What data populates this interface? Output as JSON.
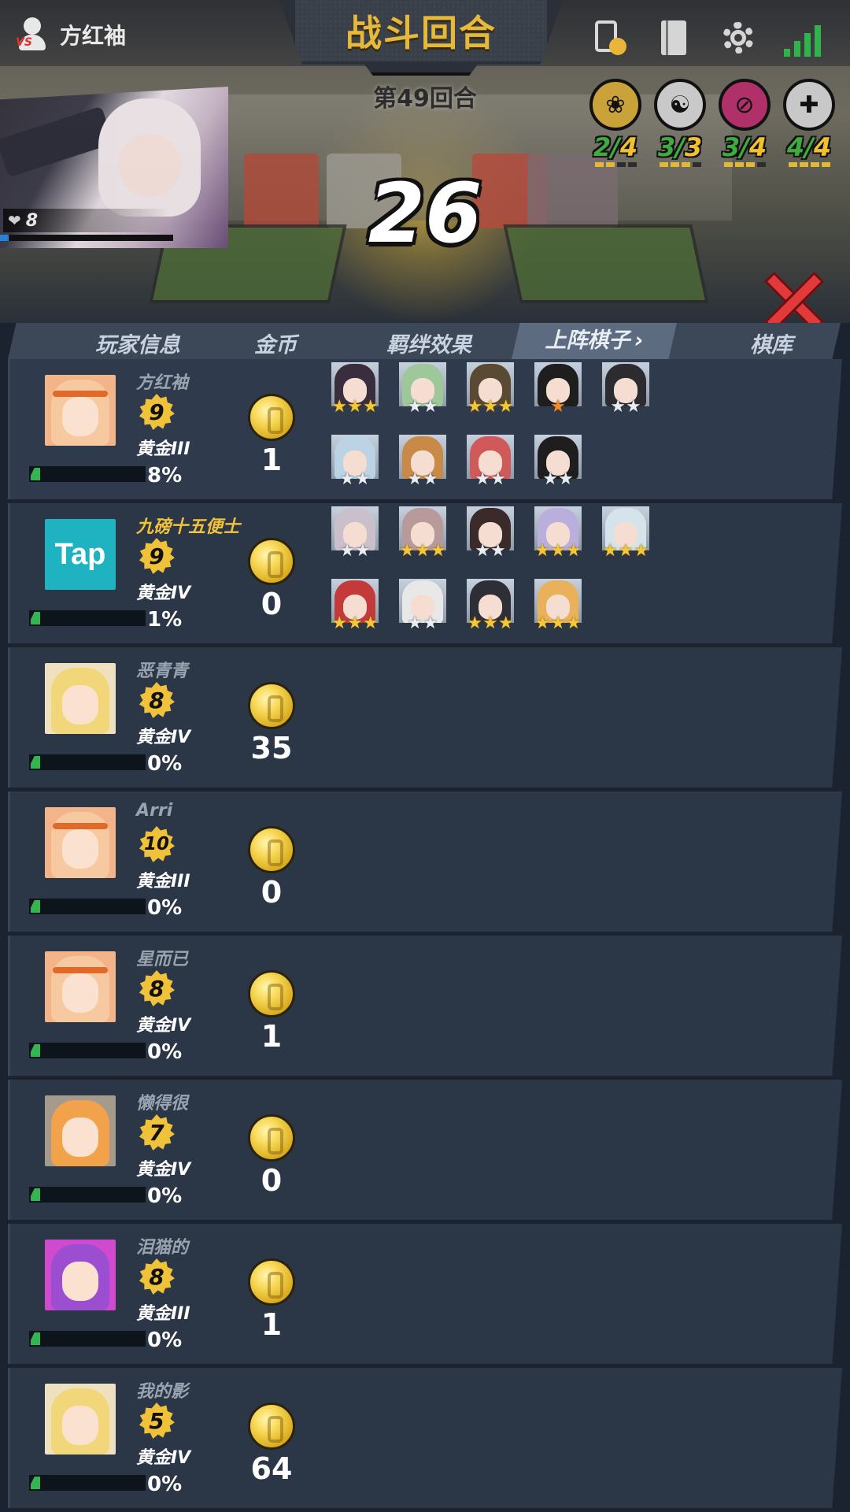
{
  "header": {
    "player_name": "方红袖",
    "title": "战斗回合",
    "round_label": "第49回合",
    "timer": "26",
    "life": "8",
    "life_fraction": 0.05
  },
  "colors": {
    "gold_accent": "#e6b93a",
    "panel": "#2b3646",
    "tab_bar": "#3c4757",
    "xp_fill": "#34b552",
    "close": "#e23a3a"
  },
  "top_icons": [
    "phone-sync-icon",
    "book-icon",
    "gear-icon",
    "signal-icon"
  ],
  "synergies": [
    {
      "icon": "lotus-icon",
      "current": "2",
      "total": "4",
      "disc_color": "#c9a23a",
      "bars": 2
    },
    {
      "icon": "yinyang-icon",
      "current": "3",
      "total": "3",
      "disc_color": "#c9c9c9",
      "bars": 3
    },
    {
      "icon": "sword-circle-icon",
      "current": "3",
      "total": "4",
      "disc_color": "#b0306a",
      "bars": 3
    },
    {
      "icon": "cross-icon",
      "current": "4",
      "total": "4",
      "disc_color": "#c8c8c8",
      "bars": 4
    }
  ],
  "tabs": {
    "player_info": "玩家信息",
    "gold": "金币",
    "synergy": "羁绊效果",
    "deployed": "上阵棋子",
    "bench": "棋库"
  },
  "players": [
    {
      "name": "方红袖",
      "level": "9",
      "rank": "黄金III",
      "pct": "8%",
      "gold": "1",
      "avatar": "orange-hair-girl",
      "name_color": "gray",
      "pieces": [
        {
          "stars": 3,
          "star_type": "gold",
          "hair": "#3a2e3e"
        },
        {
          "stars": 2,
          "star_type": "white",
          "hair": "#9ec79a"
        },
        {
          "stars": 3,
          "star_type": "gold",
          "hair": "#5a4a34"
        },
        {
          "stars": 1,
          "star_type": "orange",
          "hair": "#1e1e1e"
        },
        {
          "stars": 2,
          "star_type": "white",
          "hair": "#2b2b30"
        },
        {
          "stars": 2,
          "star_type": "white",
          "hair": "#bcd3e6"
        },
        {
          "stars": 2,
          "star_type": "white",
          "hair": "#c88a46"
        },
        {
          "stars": 2,
          "star_type": "white",
          "hair": "#d05a5a"
        },
        {
          "stars": 2,
          "star_type": "white",
          "hair": "#1e1e1e"
        }
      ]
    },
    {
      "name": "九磅十五便士",
      "level": "9",
      "rank": "黄金IV",
      "pct": "1%",
      "gold": "0",
      "avatar": "tap",
      "avatar_text": "Tap",
      "name_color": "gold",
      "pieces": [
        {
          "stars": 2,
          "star_type": "white",
          "hair": "#c9c0cc"
        },
        {
          "stars": 3,
          "star_type": "gold",
          "hair": "#b89a9a"
        },
        {
          "stars": 2,
          "star_type": "white",
          "hair": "#3a2a2a"
        },
        {
          "stars": 3,
          "star_type": "gold",
          "hair": "#b9aedc"
        },
        {
          "stars": 3,
          "star_type": "gold",
          "hair": "#d4e4ea"
        },
        {
          "stars": 3,
          "star_type": "gold",
          "hair": "#c23a3a"
        },
        {
          "stars": 2,
          "star_type": "white",
          "hair": "#e8e8e8"
        },
        {
          "stars": 3,
          "star_type": "gold",
          "hair": "#2e2e36"
        },
        {
          "stars": 3,
          "star_type": "gold",
          "hair": "#e9b25a"
        }
      ]
    },
    {
      "name": "恶青青",
      "level": "8",
      "rank": "黄金IV",
      "pct": "0%",
      "gold": "35",
      "avatar": "blonde-cat-girl",
      "name_color": "gray",
      "pieces": []
    },
    {
      "name": "Arri",
      "level": "10",
      "rank": "黄金III",
      "pct": "0%",
      "gold": "0",
      "avatar": "orange-hair-girl",
      "name_color": "gray",
      "pieces": []
    },
    {
      "name": "星而已",
      "level": "8",
      "rank": "黄金IV",
      "pct": "0%",
      "gold": "1",
      "avatar": "orange-hair-girl",
      "name_color": "gray",
      "pieces": []
    },
    {
      "name": "懒得很",
      "level": "7",
      "rank": "黄金IV",
      "pct": "0%",
      "gold": "0",
      "avatar": "spiky-hair-boy",
      "name_color": "gray",
      "pieces": []
    },
    {
      "name": "泪猫的",
      "level": "8",
      "rank": "黄金III",
      "pct": "0%",
      "gold": "1",
      "avatar": "purple-maid",
      "name_color": "gray",
      "pieces": []
    },
    {
      "name": "我的影",
      "level": "5",
      "rank": "黄金IV",
      "pct": "0%",
      "gold": "64",
      "avatar": "blonde-cat-girl",
      "name_color": "gray",
      "pieces": []
    }
  ]
}
